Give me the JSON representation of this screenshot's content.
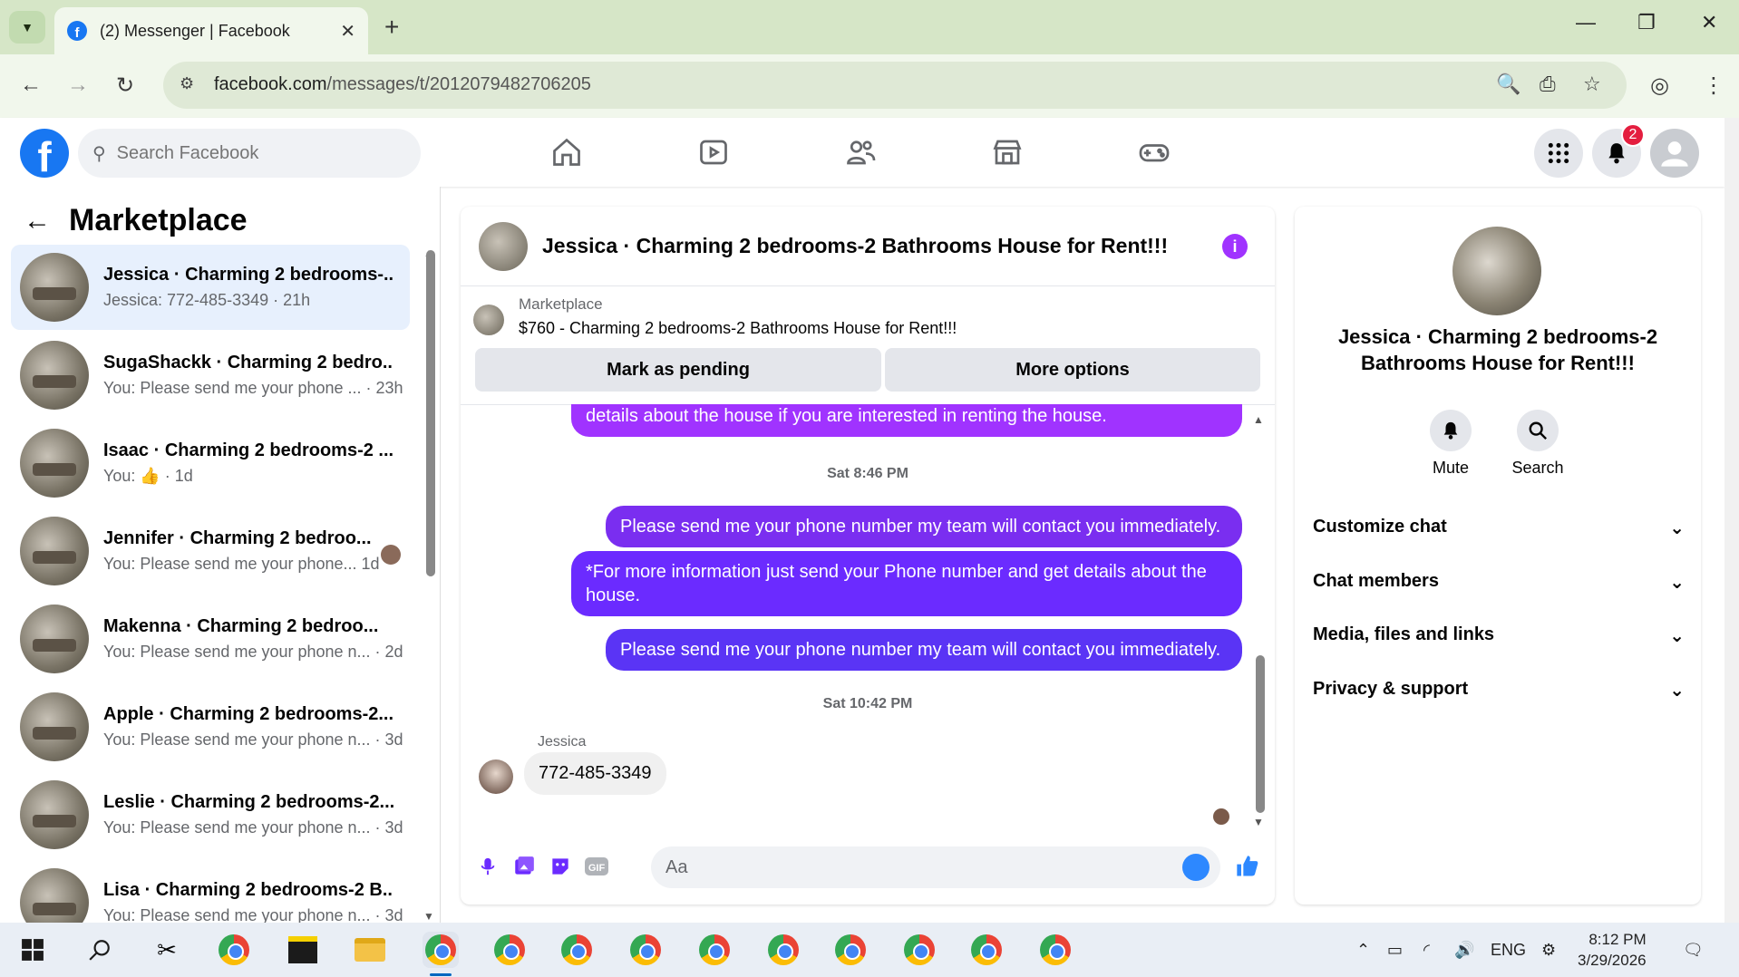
{
  "browser": {
    "tab_title": "(2) Messenger | Facebook",
    "url_host": "facebook.com",
    "url_path": "/messages/t/2012079482706205"
  },
  "fb": {
    "search_placeholder": "Search Facebook",
    "notifications_count": "2"
  },
  "sidebar": {
    "title": "Marketplace",
    "conversations": [
      {
        "name": "Jessica · Charming 2 bedrooms-...",
        "sub": "Jessica: 772-485-3349 · 21h",
        "active": true
      },
      {
        "name": "SugaShackk · Charming 2 bedro...",
        "sub": "You: Please send me your phone ... · 23h"
      },
      {
        "name": "Isaac · Charming 2 bedrooms-2 ...",
        "sub": "You: 👍 · 1d"
      },
      {
        "name": "Jennifer · Charming 2 bedroo...",
        "sub": "You: Please send me your phone... 1d"
      },
      {
        "name": "Makenna · Charming 2 bedroo...",
        "sub": "You: Please send me your phone n... · 2d"
      },
      {
        "name": "Apple · Charming 2 bedrooms-2...",
        "sub": "You: Please send me your phone n... · 3d"
      },
      {
        "name": "Leslie · Charming 2 bedrooms-2...",
        "sub": "You: Please send me your phone n... · 3d"
      },
      {
        "name": "Lisa · Charming 2 bedrooms-2 B...",
        "sub": "You: Please send me your phone n... · 3d"
      }
    ]
  },
  "chat": {
    "title": "Jessica · Charming 2 bedrooms-2 Bathrooms House for Rent!!!",
    "marketplace_label": "Marketplace",
    "listing": "$760 - Charming 2 bedrooms-2 Bathrooms House for Rent!!!",
    "mark_pending": "Mark as pending",
    "more_options": "More options",
    "partial_bubble": "details about the house if you are interested in renting the house.",
    "ts1": "Sat 8:46 PM",
    "msg1": "Please send me your phone number my team will contact you immediately.",
    "msg2": "*For more information just send your Phone number and  get details about the house.",
    "msg3": "Please send me your phone number my team will contact you immediately.",
    "ts2": "Sat 10:42 PM",
    "sender": "Jessica",
    "reply": "772-485-3349",
    "composer_placeholder": "Aa"
  },
  "right_panel": {
    "name": "Jessica · Charming 2 bedrooms-2 Bathrooms House for Rent!!!",
    "mute": "Mute",
    "search": "Search",
    "rows": [
      "Customize chat",
      "Chat members",
      "Media, files and links",
      "Privacy & support"
    ]
  },
  "taskbar": {
    "lang": "ENG",
    "time": "8:12 PM",
    "date": "3/29/2026"
  },
  "colors": {
    "fb_blue": "#1877f2",
    "bubble_purple": "#a033ff",
    "bubble_indigo": "#6b2bff",
    "active_conv": "#e7f0fd"
  }
}
